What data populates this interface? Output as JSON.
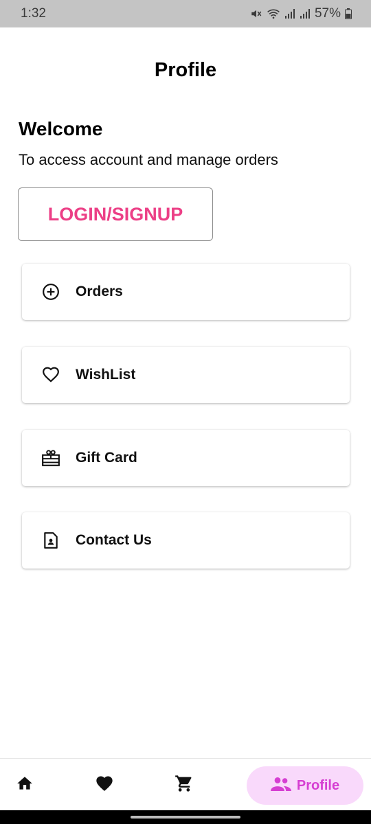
{
  "status_bar": {
    "time": "1:32",
    "battery": "57%",
    "icons": [
      "mute-icon",
      "wifi-icon",
      "signal-icon",
      "signal-icon",
      "battery-icon"
    ]
  },
  "header": {
    "title": "Profile"
  },
  "welcome": {
    "title": "Welcome",
    "subtitle": "To access account and manage orders"
  },
  "login_button": {
    "label": "LOGIN/SIGNUP",
    "color": "#ec3f86"
  },
  "menu": {
    "items": [
      {
        "label": "Orders",
        "icon": "plus-circle-icon"
      },
      {
        "label": "WishList",
        "icon": "heart-outline-icon"
      },
      {
        "label": "Gift Card",
        "icon": "gift-card-icon"
      },
      {
        "label": "Contact Us",
        "icon": "contact-document-icon"
      }
    ]
  },
  "bottom_nav": {
    "items": [
      {
        "icon": "home-icon"
      },
      {
        "icon": "heart-icon"
      },
      {
        "icon": "cart-icon"
      },
      {
        "icon": "people-icon",
        "label": "Profile",
        "active": true
      }
    ],
    "active_color": "#d63ed2",
    "active_bg": "#f9d9fb"
  }
}
